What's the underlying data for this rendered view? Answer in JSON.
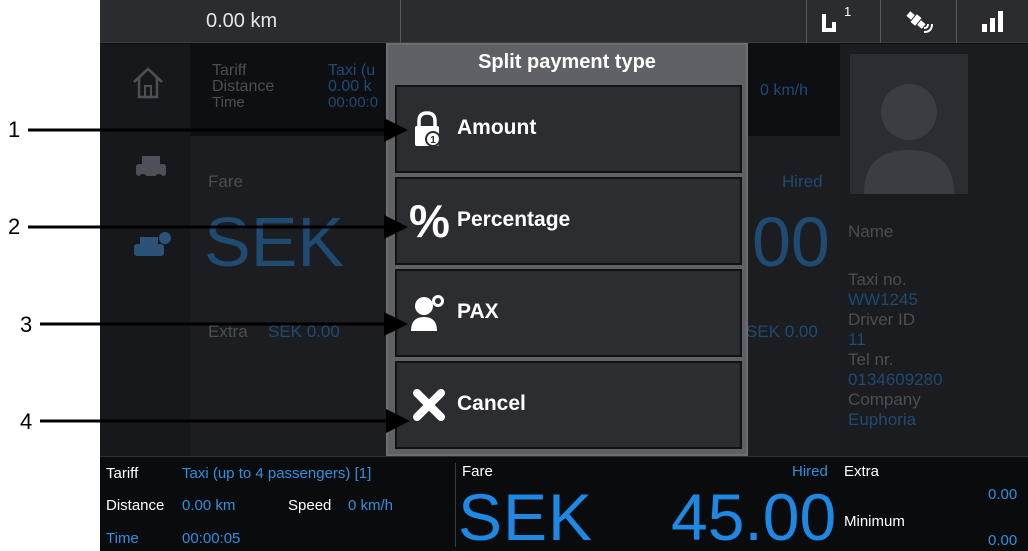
{
  "status": {
    "distance": "0.00 km",
    "notification_badge": "1"
  },
  "background": {
    "tariff_label": "Tariff",
    "tariff_value": "Taxi (u",
    "distance_label": "Distance",
    "distance_value": "0.00 k",
    "time_label": "Time",
    "time_value": "00:00:0",
    "speed_value": "0 km/h",
    "fare_label": "Fare",
    "hired_label": "Hired",
    "sek_big": "SEK",
    "amount_big_fragment": "00",
    "extra_label": "Extra",
    "extra_value": "SEK 0.00",
    "min_value_fragment": "SEK 0.00",
    "driver": {
      "name_label": "Name",
      "taxi_no_label": "Taxi no.",
      "taxi_no_value": "WW1245",
      "driver_id_label": "Driver ID",
      "driver_id_value": "11",
      "tel_label": "Tel nr.",
      "tel_value": "0134609280",
      "company_label": "Company",
      "company_value": "Euphoria"
    }
  },
  "dialog": {
    "title": "Split payment type",
    "options": [
      {
        "label": "Amount",
        "icon": "lock-coin-icon"
      },
      {
        "label": "Percentage",
        "icon": "percent-icon"
      },
      {
        "label": "PAX",
        "icon": "person-coin-icon"
      },
      {
        "label": "Cancel",
        "icon": "close-icon"
      }
    ]
  },
  "infobar": {
    "tariff_label": "Tariff",
    "tariff_value": "Taxi (up to 4 passengers) [1]",
    "distance_label": "Distance",
    "distance_value": "0.00 km",
    "speed_label": "Speed",
    "speed_value": "0 km/h",
    "time_label": "Time",
    "time_value": "00:00:05",
    "fare_label": "Fare",
    "hired_label": "Hired",
    "currency": "SEK",
    "amount": "45.00",
    "extra_label": "Extra",
    "extra_value": "0.00",
    "minimum_label": "Minimum",
    "minimum_value": "0.00"
  },
  "callouts": [
    "1",
    "2",
    "3",
    "4"
  ],
  "colors": {
    "accent_blue": "#1e88e5",
    "dialog_bg": "#5f6166",
    "option_bg": "#2b2d31"
  }
}
